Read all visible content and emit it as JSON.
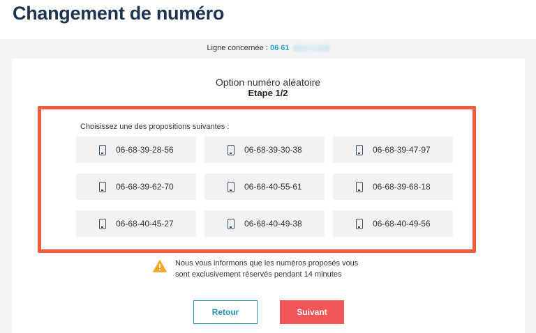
{
  "page": {
    "title": "Changement de numéro"
  },
  "line": {
    "label": "Ligne concernée : ",
    "number_visible": "06 61"
  },
  "option": {
    "title": "Option numéro aléatoire",
    "step": "Etape 1/2"
  },
  "proposals": {
    "label": "Choisissez une des propositions suivantes :",
    "numbers": [
      "06-68-39-28-56",
      "06-68-39-30-38",
      "06-68-39-47-97",
      "06-68-39-62-70",
      "06-68-40-55-61",
      "06-68-39-68-18",
      "06-68-40-45-27",
      "06-68-40-49-38",
      "06-68-40-49-56"
    ]
  },
  "notice": {
    "line1": "Nous vous informons que les numéros proposés vous",
    "line2": "sont exclusivement réservés pendant 14 minutes"
  },
  "buttons": {
    "back": "Retour",
    "next": "Suivant"
  },
  "colors": {
    "title": "#1e3350",
    "highlight": "#f25c3c",
    "accent": "#2e93b5",
    "next_button": "#f25656",
    "warning": "#f5a623",
    "line_number": "#2aa3c6"
  },
  "icons": {
    "phone": "mobile-phone-icon",
    "warning": "warning-triangle-icon"
  }
}
